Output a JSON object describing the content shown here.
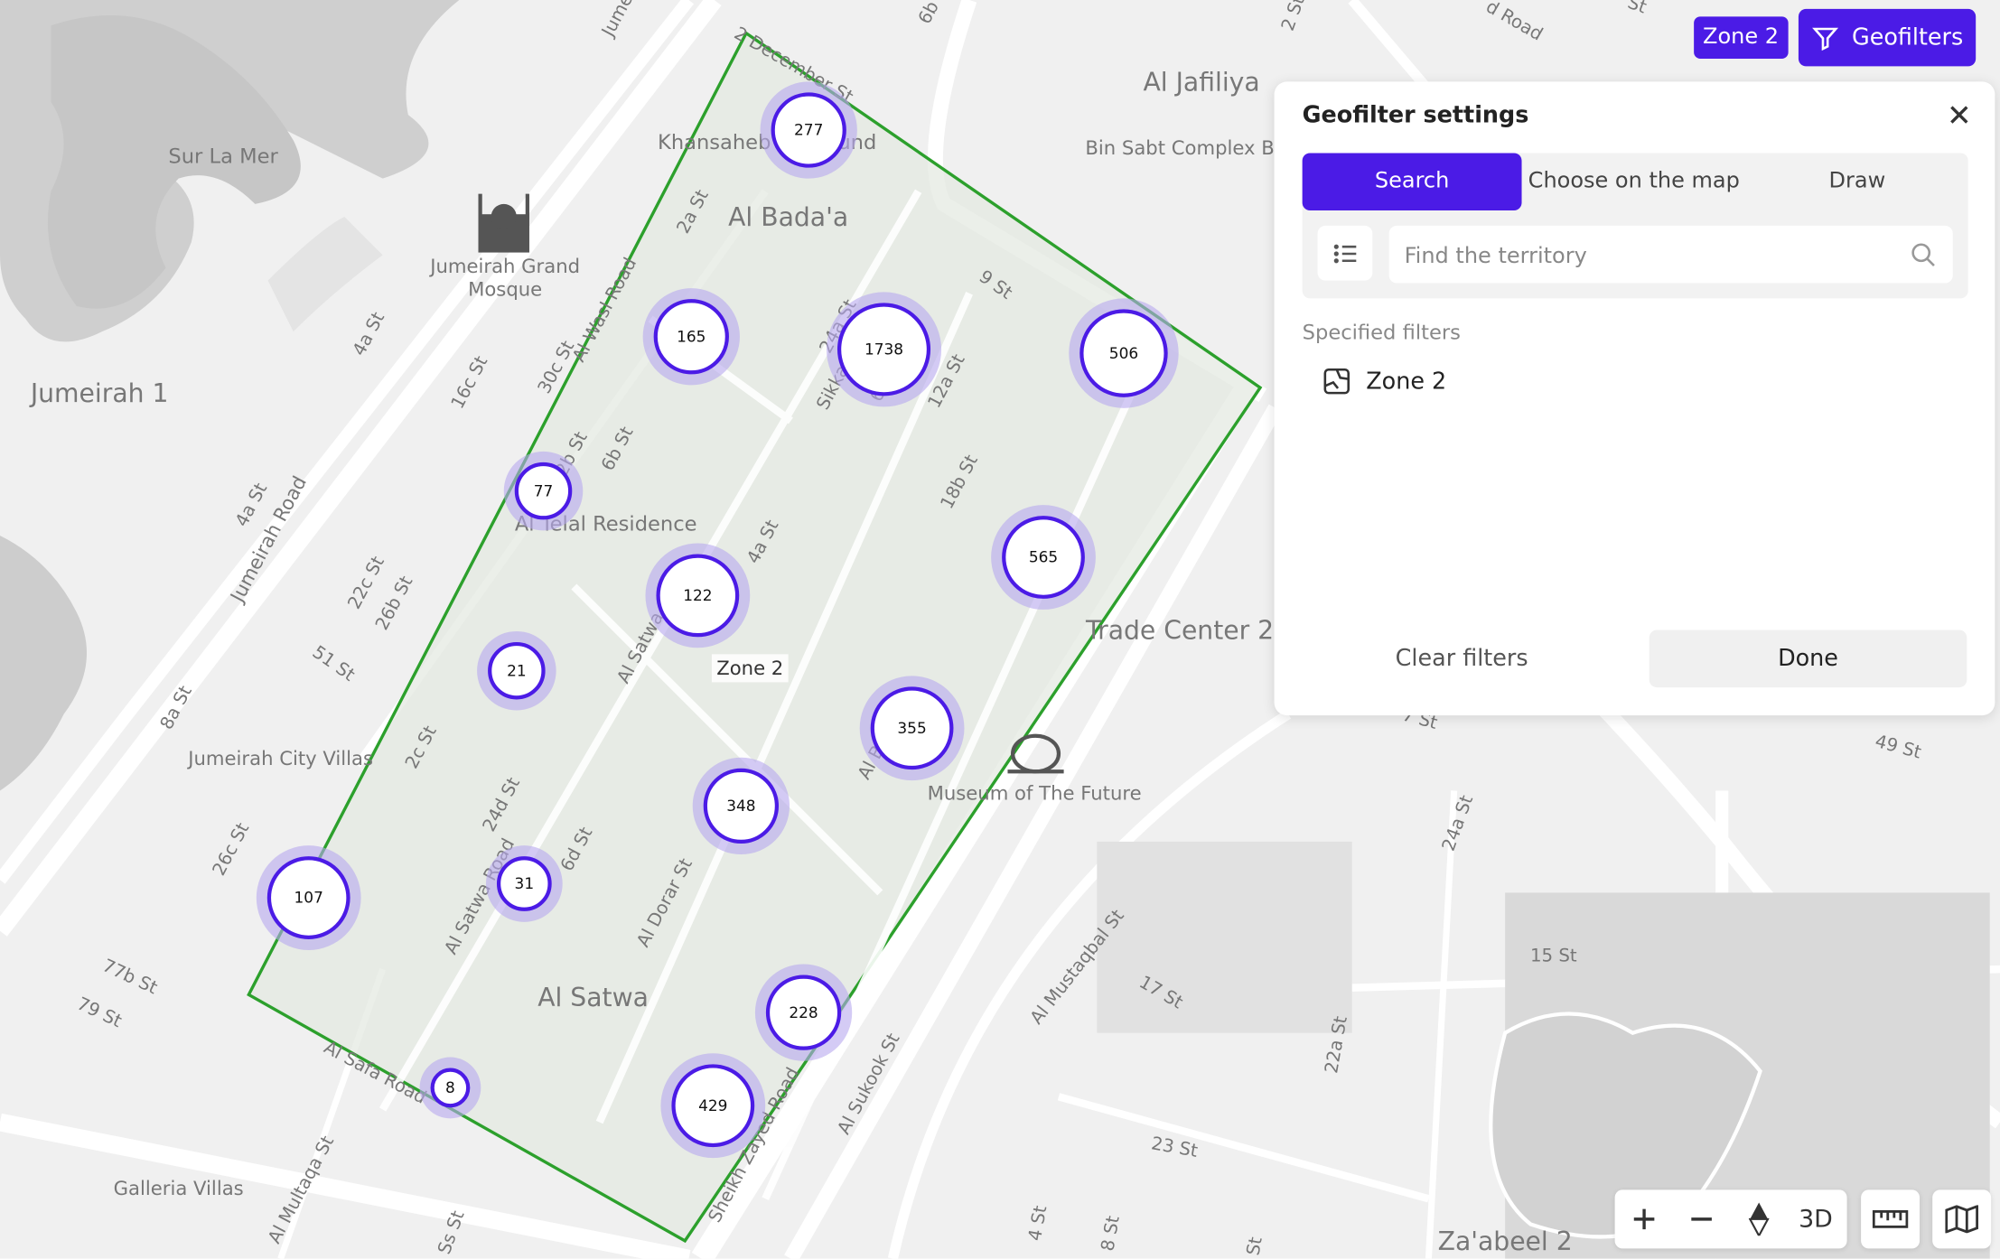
{
  "map": {
    "labels": [
      {
        "text": "Sur La Mer",
        "kind": "place"
      },
      {
        "text": "Jumeirah Grand",
        "kind": "poi"
      },
      {
        "text": "Mosque",
        "kind": "poi"
      },
      {
        "text": "Jumeirah 1",
        "kind": "district"
      },
      {
        "text": "Al Jafiliya",
        "kind": "district"
      },
      {
        "text": "Bin Sabt Complex B",
        "kind": "place"
      },
      {
        "text": "Khansaheb",
        "kind": "place"
      },
      {
        "text": "und",
        "kind": "place"
      },
      {
        "text": "Al Bada'a",
        "kind": "district"
      },
      {
        "text": "Al Telal Residence",
        "kind": "place"
      },
      {
        "text": "Trade Center 2",
        "kind": "district"
      },
      {
        "text": "Jumeirah City Villas",
        "kind": "place"
      },
      {
        "text": "Museum of The Future",
        "kind": "poi"
      },
      {
        "text": "Al Satwa",
        "kind": "district"
      },
      {
        "text": "Galleria Villas",
        "kind": "place"
      },
      {
        "text": "Za'abeel 2",
        "kind": "district"
      },
      {
        "text": "Jumeirah Road",
        "kind": "road"
      },
      {
        "text": "Al Satwa Road",
        "kind": "road"
      },
      {
        "text": "Al Satwa",
        "kind": "road"
      },
      {
        "text": "Al Dorar St",
        "kind": "road"
      },
      {
        "text": "Al Safa Road",
        "kind": "road"
      },
      {
        "text": "Al Sukook St",
        "kind": "road"
      },
      {
        "text": "Al Mustaqbal St",
        "kind": "road"
      },
      {
        "text": "Sheikh Zayed Road",
        "kind": "road"
      },
      {
        "text": "Sikka 2",
        "kind": "road"
      },
      {
        "text": "Al Multaqa St",
        "kind": "road"
      },
      {
        "text": "Al Wasl Road",
        "kind": "road"
      },
      {
        "text": "d Road",
        "kind": "road"
      },
      {
        "text": "2a St",
        "kind": "road"
      },
      {
        "text": "9 St",
        "kind": "road"
      },
      {
        "text": "24a St",
        "kind": "road"
      },
      {
        "text": "12a St",
        "kind": "road"
      },
      {
        "text": "18b St",
        "kind": "road"
      },
      {
        "text": "4a St",
        "kind": "road"
      },
      {
        "text": "6b St",
        "kind": "road"
      },
      {
        "text": "30c St",
        "kind": "road"
      },
      {
        "text": "16c St",
        "kind": "road"
      },
      {
        "text": "4a St",
        "kind": "road"
      },
      {
        "text": "4a St",
        "kind": "road"
      },
      {
        "text": "22c St",
        "kind": "road"
      },
      {
        "text": "26b St",
        "kind": "road"
      },
      {
        "text": "51 St",
        "kind": "road"
      },
      {
        "text": "8a St",
        "kind": "road"
      },
      {
        "text": "2c St",
        "kind": "road"
      },
      {
        "text": "24d St",
        "kind": "road"
      },
      {
        "text": "6d St",
        "kind": "road"
      },
      {
        "text": "26c St",
        "kind": "road"
      },
      {
        "text": "77b St",
        "kind": "road"
      },
      {
        "text": "79 St",
        "kind": "road"
      },
      {
        "text": "49 St",
        "kind": "road"
      },
      {
        "text": "24a St",
        "kind": "road"
      },
      {
        "text": "15 St",
        "kind": "road"
      },
      {
        "text": "17 St",
        "kind": "road"
      },
      {
        "text": "22a St",
        "kind": "road"
      },
      {
        "text": "23 St",
        "kind": "road"
      },
      {
        "text": "4 St",
        "kind": "road"
      },
      {
        "text": "8 St",
        "kind": "road"
      },
      {
        "text": "St",
        "kind": "road"
      },
      {
        "text": "6b",
        "kind": "road"
      },
      {
        "text": "2 St",
        "kind": "road"
      },
      {
        "text": "St",
        "kind": "road"
      },
      {
        "text": "6",
        "kind": "road"
      },
      {
        "text": "Al B",
        "kind": "road"
      },
      {
        "text": "7 St",
        "kind": "road"
      },
      {
        "text": "Ss St",
        "kind": "road"
      },
      {
        "text": "Jume",
        "kind": "road"
      },
      {
        "text": "2b St",
        "kind": "road"
      },
      {
        "text": "2 December St",
        "kind": "road"
      }
    ],
    "zone_label": "Zone 2",
    "zone_color": "#2ca02c",
    "cluster_color": "#4b1be6",
    "clusters": [
      {
        "count": "277"
      },
      {
        "count": "165"
      },
      {
        "count": "1738"
      },
      {
        "count": "506"
      },
      {
        "count": "77"
      },
      {
        "count": "122"
      },
      {
        "count": "565"
      },
      {
        "count": "21"
      },
      {
        "count": "355"
      },
      {
        "count": "348"
      },
      {
        "count": "107"
      },
      {
        "count": "31"
      },
      {
        "count": "228"
      },
      {
        "count": "8"
      },
      {
        "count": "429"
      }
    ]
  },
  "header": {
    "zone_chip": "Zone 2",
    "geofilters_label": "Geofilters",
    "accent": "#4b1be6"
  },
  "panel": {
    "title": "Geofilter settings",
    "tabs": [
      {
        "label": "Search",
        "active": true
      },
      {
        "label": "Choose on the map",
        "active": false
      },
      {
        "label": "Draw",
        "active": false
      }
    ],
    "search_placeholder": "Find the territory",
    "specified_label": "Specified filters",
    "filters": [
      {
        "label": "Zone 2",
        "icon": "territory-icon"
      }
    ],
    "clear_label": "Clear filters",
    "done_label": "Done"
  },
  "controls": {
    "three_d_label": "3D",
    "icons": [
      "zoom-in-icon",
      "zoom-out-icon",
      "compass-icon",
      "ruler-icon",
      "map-layers-icon"
    ]
  }
}
